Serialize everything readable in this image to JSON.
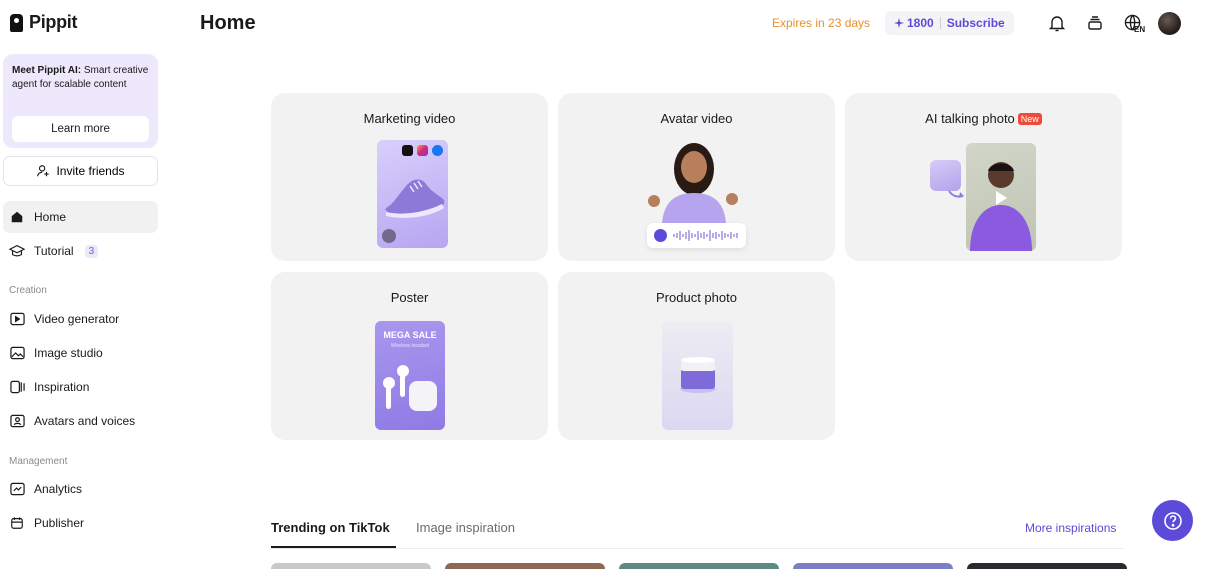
{
  "brand": {
    "name": "Pippit"
  },
  "sidebar": {
    "promo": {
      "bold": "Meet Pippit AI:",
      "text": " Smart creative agent for scalable content",
      "button": "Learn more"
    },
    "invite": "Invite friends",
    "nav_top": [
      {
        "label": "Home",
        "icon": "home-icon",
        "active": true
      },
      {
        "label": "Tutorial",
        "icon": "graduation-cap-icon",
        "badge": "3"
      }
    ],
    "creation_label": "Creation",
    "creation": [
      {
        "label": "Video generator",
        "icon": "video-icon"
      },
      {
        "label": "Image studio",
        "icon": "image-icon"
      },
      {
        "label": "Inspiration",
        "icon": "inspiration-icon"
      },
      {
        "label": "Avatars and voices",
        "icon": "avatar-icon"
      }
    ],
    "management_label": "Management",
    "management": [
      {
        "label": "Analytics",
        "icon": "chart-icon"
      },
      {
        "label": "Publisher",
        "icon": "calendar-icon"
      }
    ]
  },
  "header": {
    "title": "Home",
    "expires": "Expires in 23 days",
    "credits": "1800",
    "subscribe": "Subscribe",
    "lang": "EN"
  },
  "cards": [
    {
      "title": "Marketing video"
    },
    {
      "title": "Avatar video"
    },
    {
      "title": "AI talking photo",
      "tag": "New"
    },
    {
      "title": "Poster",
      "thumb_title": "MEGA SALE",
      "thumb_sub": "Wireless headset"
    },
    {
      "title": "Product photo"
    }
  ],
  "tabs": {
    "active": "Trending on TikTok",
    "inactive": "Image inspiration",
    "more": "More inspirations"
  },
  "colors": {
    "accent": "#5b4bd8",
    "expires": "#e8902c",
    "new_tag": "#f04a3a",
    "card_bg": "#f2f2f3"
  }
}
